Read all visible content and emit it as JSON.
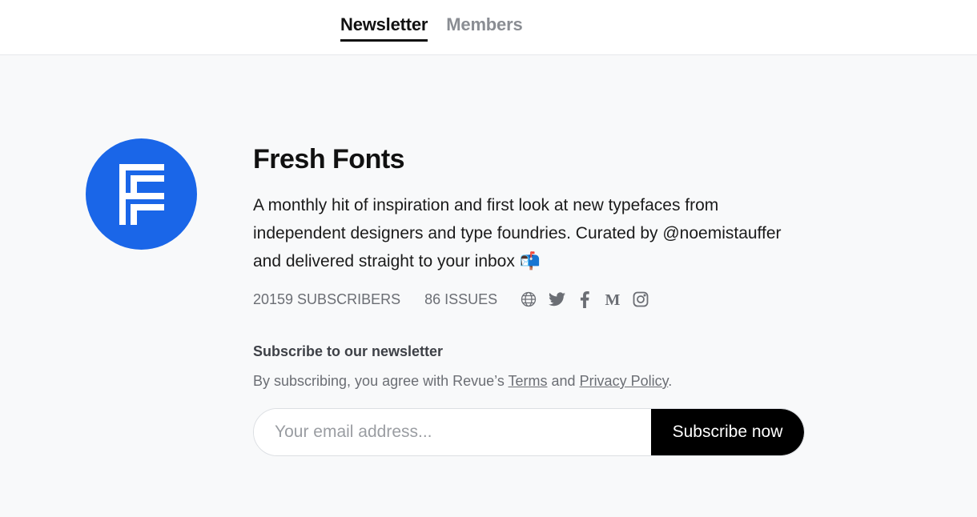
{
  "nav": {
    "tabs": [
      {
        "label": "Newsletter",
        "active": true
      },
      {
        "label": "Members",
        "active": false
      }
    ]
  },
  "profile": {
    "logo_icon": "fresh-fonts-logo",
    "logo_color": "#1a66e8",
    "title": "Fresh Fonts",
    "description": "A monthly hit of inspiration and first look at new typefaces from independent designers and type foundries. Curated by @noemistauffer and delivered straight to your inbox 📬",
    "subscribers": "20159 SUBSCRIBERS",
    "issues": "86 ISSUES",
    "social_icons": [
      "globe-icon",
      "twitter-icon",
      "facebook-icon",
      "medium-icon",
      "instagram-icon"
    ]
  },
  "subscribe": {
    "heading": "Subscribe to our newsletter",
    "terms_prefix": "By subscribing, you agree with Revue’s ",
    "terms_link": "Terms",
    "terms_and": " and ",
    "privacy_link": "Privacy Policy",
    "terms_suffix": ".",
    "email_placeholder": "Your email address...",
    "button_label": "Subscribe now"
  }
}
